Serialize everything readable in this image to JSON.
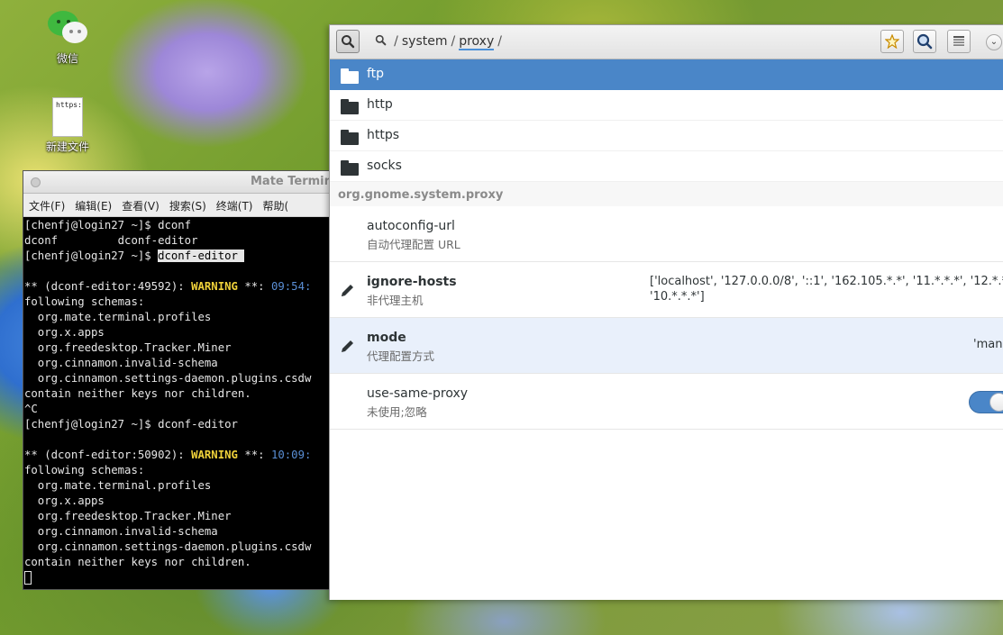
{
  "desktop": {
    "icons": [
      {
        "label": "微信"
      },
      {
        "label": "新建文件"
      }
    ],
    "newfile_glyph_text": "https:"
  },
  "terminal": {
    "title": "Mate Termin",
    "menus": [
      "文件(F)",
      "编辑(E)",
      "查看(V)",
      "搜索(S)",
      "终端(T)",
      "帮助("
    ],
    "lines": [
      {
        "text": "[chenfj@login27 ~]$ dconf"
      },
      {
        "text": "dconf         dconf-editor"
      },
      {
        "prefix": "[chenfj@login27 ~]$ ",
        "selected": "dconf-editor "
      },
      {
        "text": ""
      },
      {
        "prefix": "** (dconf-editor:49592): ",
        "warn": "WARNING",
        "mid": " **: ",
        "time": "09:54:"
      },
      {
        "text": "following schemas:"
      },
      {
        "text": "  org.mate.terminal.profiles"
      },
      {
        "text": "  org.x.apps"
      },
      {
        "text": "  org.freedesktop.Tracker.Miner"
      },
      {
        "text": "  org.cinnamon.invalid-schema"
      },
      {
        "text": "  org.cinnamon.settings-daemon.plugins.csdw"
      },
      {
        "text": "contain neither keys nor children."
      },
      {
        "text": "^C"
      },
      {
        "text": "[chenfj@login27 ~]$ dconf-editor"
      },
      {
        "text": ""
      },
      {
        "prefix": "** (dconf-editor:50902): ",
        "warn": "WARNING",
        "mid": " **: ",
        "time": "10:09:"
      },
      {
        "text": "following schemas:"
      },
      {
        "text": "  org.mate.terminal.profiles"
      },
      {
        "text": "  org.x.apps"
      },
      {
        "text": "  org.freedesktop.Tracker.Miner"
      },
      {
        "text": "  org.cinnamon.invalid-schema"
      },
      {
        "text": "  org.cinnamon.settings-daemon.plugins.csdw"
      },
      {
        "text": "contain neither keys nor children."
      }
    ]
  },
  "dconf": {
    "path": {
      "root_icon": "search-icon",
      "segments": [
        "system",
        "proxy"
      ],
      "separator": "/"
    },
    "folders": [
      {
        "name": "ftp",
        "selected": true
      },
      {
        "name": "http",
        "selected": false
      },
      {
        "name": "https",
        "selected": false
      },
      {
        "name": "socks",
        "selected": false
      }
    ],
    "schema_header": "org.gnome.system.proxy",
    "keys": [
      {
        "name": "autoconfig-url",
        "desc": "自动代理配置 URL",
        "value": "",
        "modified": false
      },
      {
        "name": "ignore-hosts",
        "desc": "非代理主机",
        "value_line1": "['localhost', '127.0.0.0/8', '::1', '162.105.*.*', '11.*.*.*', '12.*.*",
        "value_line2": "'10.*.*.*']",
        "modified": true
      },
      {
        "name": "mode",
        "desc": "代理配置方式",
        "value": "'man",
        "modified": true
      },
      {
        "name": "use-same-proxy",
        "desc": "未使用;忽略",
        "toggle_on": true,
        "modified": false
      }
    ],
    "accent_color": "#4a86c8"
  }
}
